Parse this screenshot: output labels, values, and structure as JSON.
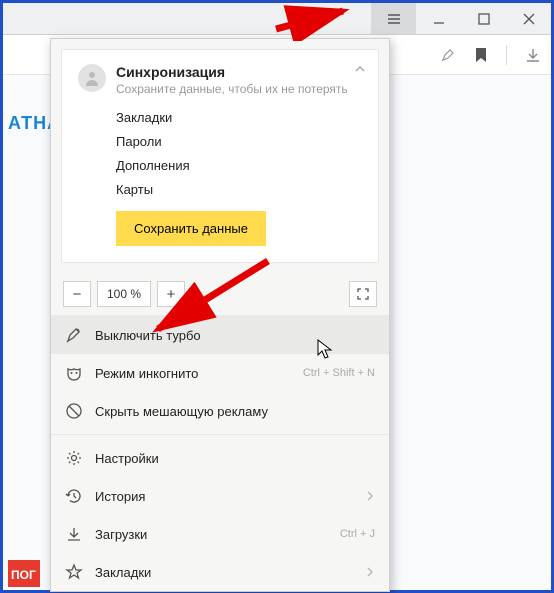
{
  "titlebar": {
    "tab_icon": "tab-overlap"
  },
  "toolbar": {
    "icons": [
      "rocket",
      "bookmark",
      "divider",
      "download"
    ]
  },
  "background": {
    "left_text": "АТНА",
    "red_tag": "ПОГ"
  },
  "sync": {
    "title": "Синхронизация",
    "subtitle": "Сохраните данные, чтобы их не потерять",
    "links": [
      "Закладки",
      "Пароли",
      "Дополнения",
      "Карты"
    ],
    "button": "Сохранить данные"
  },
  "zoom": {
    "minus": "−",
    "value": "100 %",
    "plus": "+"
  },
  "items": [
    {
      "icon": "rocket",
      "label": "Выключить турбо",
      "hint": "",
      "hover": true,
      "chev": false
    },
    {
      "icon": "mask",
      "label": "Режим инкогнито",
      "hint": "Ctrl + Shift + N",
      "hover": false,
      "chev": false
    },
    {
      "icon": "block",
      "label": "Скрыть мешающую рекламу",
      "hint": "",
      "hover": false,
      "chev": false
    },
    {
      "sep": true
    },
    {
      "icon": "gear",
      "label": "Настройки",
      "hint": "",
      "hover": false,
      "chev": false
    },
    {
      "icon": "history",
      "label": "История",
      "hint": "",
      "hover": false,
      "chev": true
    },
    {
      "icon": "download",
      "label": "Загрузки",
      "hint": "Ctrl + J",
      "hover": false,
      "chev": false
    },
    {
      "icon": "star",
      "label": "Закладки",
      "hint": "",
      "hover": false,
      "chev": true
    }
  ]
}
